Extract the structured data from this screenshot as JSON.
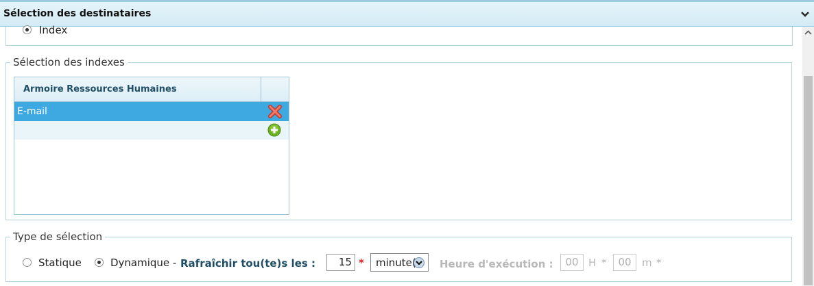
{
  "header": {
    "title": "Sélection des destinataires",
    "collapse_icon": "chevron-down-icon"
  },
  "top_option": {
    "label": "Index",
    "checked": true
  },
  "indexes_section": {
    "legend": "Sélection des indexes",
    "grid": {
      "column_header": "Armoire Ressources Humaines",
      "rows": [
        {
          "label": "E-mail",
          "selected": true,
          "action_icon": "delete-icon"
        }
      ],
      "add_icon": "add-icon"
    }
  },
  "selection_type": {
    "legend": "Type de sélection",
    "options": [
      {
        "label": "Statique",
        "checked": false
      },
      {
        "label": "Dynamique -",
        "checked": true
      }
    ],
    "refresh_label": "Rafraîchir tou(te)s les :",
    "refresh_value": "15",
    "required_mark": "*",
    "unit": {
      "selected": "minute(s)",
      "visible_text": "minute("
    },
    "exec_label": "Heure d'exécution :",
    "hours_value": "00",
    "hours_unit": "H",
    "minutes_value": "00",
    "minutes_unit": "m"
  },
  "colors": {
    "selected_row": "#3ea8e0",
    "accent_text": "#1f4e66",
    "required": "#e02020"
  }
}
